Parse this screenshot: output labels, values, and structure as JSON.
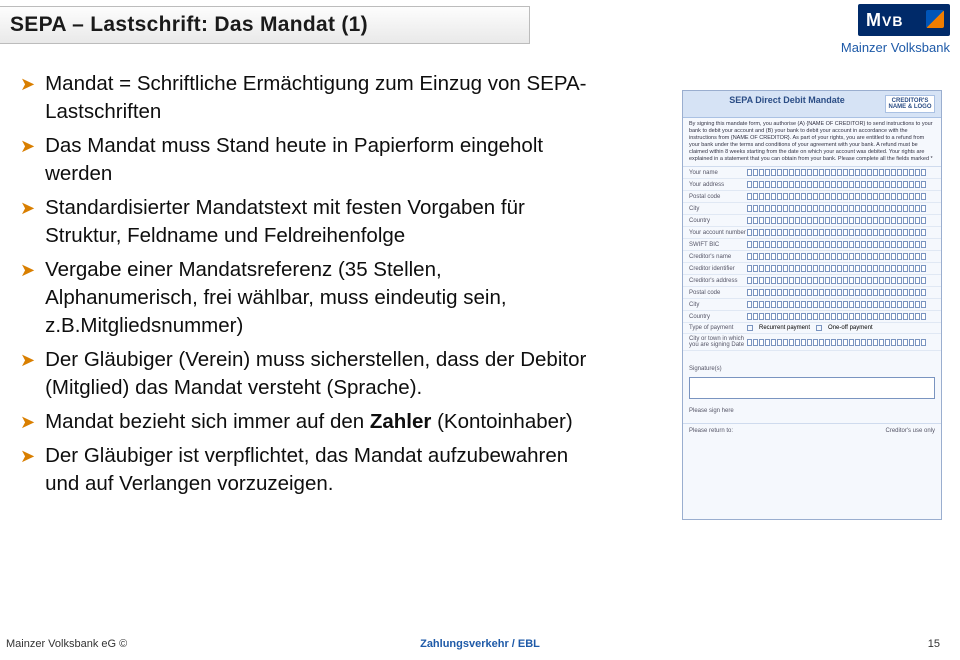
{
  "title": "SEPA – Lastschrift: Das Mandat (1)",
  "brand": {
    "logo_text_m": "M",
    "logo_text_vb": "VB",
    "name": "Mainzer Volksbank"
  },
  "bullets": [
    {
      "text": "Mandat = Schriftliche Ermächtigung zum Einzug von SEPA-Lastschriften"
    },
    {
      "text": "Das Mandat muss Stand heute in Papierform eingeholt werden"
    },
    {
      "text": "Standardisierter Mandatstext mit festen Vorgaben für Struktur, Feldname und Feldreihenfolge"
    },
    {
      "text": "Vergabe einer Mandatsreferenz (35 Stellen, Alphanumerisch, frei wählbar, muss eindeutig sein, z.B.Mitgliedsnummer)"
    },
    {
      "text": "Der Gläubiger (Verein) muss sicherstellen, dass der Debitor (Mitglied) das Mandat versteht (Sprache)."
    },
    {
      "html": "Mandat bezieht sich immer auf den <b>Zahler</b> (Kontoinhaber)"
    },
    {
      "text": "Der Gläubiger ist verpflichtet, das Mandat aufzubewahren und auf Verlangen vorzuzeigen."
    }
  ],
  "form": {
    "header_title": "SEPA Direct Debit Mandate",
    "header_creditor": "CREDITOR'S NAME & LOGO",
    "intro": "By signing this mandate form, you authorise (A) {NAME OF CREDITOR} to send instructions to your bank to debit your account and (B) your bank to debit your account in accordance with the instructions from {NAME OF CREDITOR}. As part of your rights, you are entitled to a refund from your bank under the terms and conditions of your agreement with your bank. A refund must be claimed within 8 weeks starting from the date on which your account was debited. Your rights are explained in a statement that you can obtain from your bank. Please complete all the fields marked *",
    "labels": {
      "your_name": "Your name",
      "address": "Your address",
      "postal": "Postal code",
      "city": "City",
      "country": "Country",
      "iban": "Your account number",
      "bic": "SWIFT BIC",
      "creditor_name": "Creditor's name",
      "creditor_id": "Creditor identifier",
      "cred_addr": "Creditor's address",
      "cred_postal": "Postal code",
      "cred_city": "City",
      "cred_country": "Country",
      "contract": "Type of payment",
      "recurrent": "Recurrent payment",
      "oneoff": "One-off payment",
      "date_place": "City or town in which you are signing  Date",
      "signatures": "Signature(s)",
      "sign_here": "Please sign here",
      "return_to": "Please return to:",
      "cred_use": "Creditor's use only"
    }
  },
  "footer": {
    "left": "Mainzer Volksbank eG ©",
    "center": "Zahlungsverkehr / EBL",
    "right": "15"
  }
}
